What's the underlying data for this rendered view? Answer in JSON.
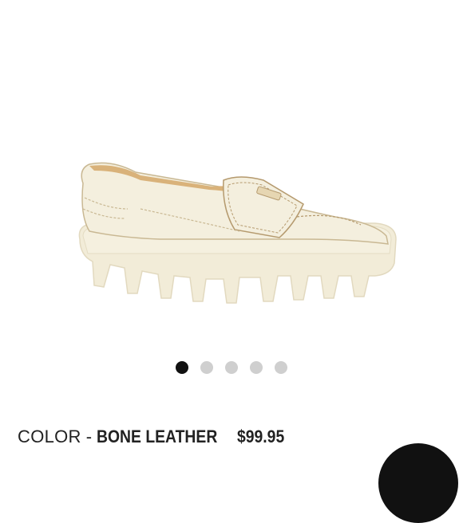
{
  "product": {
    "image_alt": "bone leather lug-sole penny loafer",
    "color_label": "COLOR",
    "separator": "-",
    "color_value": "BONE LEATHER",
    "price": "$99.95"
  },
  "carousel": {
    "slide_count": 5,
    "active_index": 0,
    "active_color": "#111111",
    "inactive_color": "#cfcfcf"
  },
  "colors": {
    "shoe": "#f2ecd8",
    "stitch": "#b59a6e",
    "lining": "#d9b27a"
  }
}
